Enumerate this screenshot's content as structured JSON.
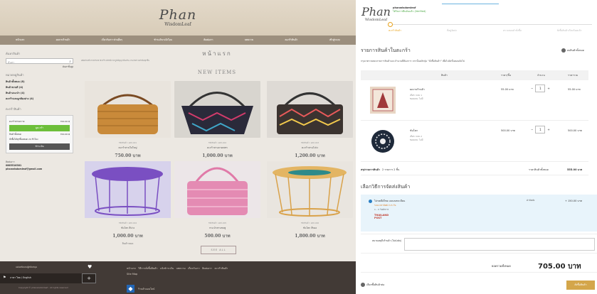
{
  "left": {
    "logo": {
      "line1": "Phan",
      "line2": "WisdomLeaf"
    },
    "nav": [
      "หน้าแรก",
      "ผลงานร้านค้า",
      "เกี่ยวกับเรา-ส่วนอื่นๆ",
      "ชำระเงิน-แจ้งโอน",
      "ติดต่อเรา",
      "บทความ",
      "ตะกร้าสินค้า",
      "เข้าสู่ระบบ"
    ],
    "sidebar": {
      "search_heading": "ค้นหาสินค้า",
      "search_placeholder": "ค้นหา",
      "advanced_search": "ค้นหาขั้นสูง",
      "categories_heading": "หมวดหมู่สินค้า",
      "categories": [
        "สินค้าทั้งหมด (8)",
        "สินค้าขายดี (4)",
        "สินค้าแนะนำ (4)",
        "ตะกร้าและผูกท้องย่าง (4)"
      ],
      "cart_heading": "ตะกร้าสินค้า",
      "cart_rows": [
        {
          "label": "ตะกร้าสานหวาย",
          "value": "700.00 ฿"
        },
        {
          "label": "สินค้าทั้งหมด",
          "value": "700.00 ฿"
        }
      ],
      "view_cart": "ดูตะกร้า",
      "cart_note": "สั่งซื้อได้ทุกชิ้นตลอด 24 ชั่วโมง",
      "checkout": "ชำระเงิน",
      "contact_heading": "ติดต่อเรา",
      "phone": "0865516381",
      "email": "phanwisdomleaf@gmail.com"
    },
    "main": {
      "title": "หน้าแรก",
      "intro": "ผลิตภัณฑ์จากธรรมชาติ สร้างสรรค์จากภูมิปัญญาท้องถิ่น งานจักสานทำมือทุกชิ้น",
      "new_items": "NEW ITEMS",
      "products": [
        {
          "code": "รหัสสินค้า: ผลส-001",
          "name": "ตะกร้าสานใบใหญ่",
          "price": "750.00 บาท",
          "badge": ""
        },
        {
          "code": "รหัสสินค้า: ผลส-002",
          "name": "ตะกร้าสานลายเพชร",
          "price": "1,000.00 บาท",
          "badge": ""
        },
        {
          "code": "รหัสสินค้า: ผลส-003",
          "name": "ตะกร้าสานโปร่ง",
          "price": "1,200.00 บาท",
          "badge": ""
        },
        {
          "code": "รหัสสินค้า: ผลส-004",
          "name": "ขันโตก สีม่วง",
          "price": "1,000.00 บาท",
          "badge": "สินค้าหมด"
        },
        {
          "code": "รหัสสินค้า: ผลส-005",
          "name": "กระเป๋าสานชมพู",
          "price": "500.00 บาท",
          "badge": ""
        },
        {
          "code": "รหัสสินค้า: ผลส-006",
          "name": "ขันโตก สีทอง",
          "price": "1,800.00 บาท",
          "badge": ""
        }
      ],
      "see_all": "SEE ALL"
    },
    "footer": {
      "left_text": "แผ่นหลังและผู้สนับสนุน",
      "nav": [
        "หน้าแรก",
        "วิธีการสั่งซื้อสินค้า",
        "แจ้งชำระเงิน",
        "บทความ",
        "เกี่ยวกับเรา",
        "ติดต่อเรา",
        "ตะกร้าสินค้า",
        "Site Map"
      ],
      "lang": "ภาษา ไทย / English",
      "plus": "+",
      "copyright": "Copyright © phanwisdomleaf - All rights reserved",
      "badge_text": "ร้านค้าออนไลน์",
      "badge_letter": "◆"
    }
  },
  "right": {
    "logo": {
      "line1": "Phan",
      "line2": "WisdomLeaf"
    },
    "shop": {
      "name": "phanwisdomleaf",
      "status": "ได้รับการยืนยันแล้ว (Verified)"
    },
    "steps": [
      "ตะกร้าสินค้า",
      "ที่อยู่จัดส่ง",
      "ตรวจสอบคำสั่งซื้อ",
      "สั่งซื้อสินค้าเรียบร้อยแล้ว"
    ],
    "cart_title": "รายการสินค้าในตะกร้า",
    "clear_cart": "ลบสินค้าทั้งหมด",
    "instructions": "กรุณาตรวจสอบรายการสินค้าและจำนวนที่ต้องการ จากนั้นคลิกปุ่ม \"สั่งซื้อสินค้า\" เพื่อไปยังขั้นตอนถัดไป",
    "columns": [
      "สินค้า",
      "ราคา/ชิ้น",
      "จำนวน",
      "ราคารวม"
    ],
    "items": [
      {
        "name": "ผลงานร้านค้า",
        "sub1": "เลือก: แบบ 1",
        "sub2": "ของแถม: ไม่มี",
        "unit": "55.00 บาท",
        "qty": "1",
        "total": "55.00 บาท"
      },
      {
        "name": "ขันโตก",
        "sub1": "เลือก: แบบ 2",
        "sub2": "ของแถม: ไม่มี",
        "unit": "500.00 บาท",
        "qty": "1",
        "total": "500.00 บาท"
      }
    ],
    "summary": {
      "label": "สรุปรายการสินค้า",
      "count": "2 รายการ 2 ชิ้น",
      "subtotal_label": "ราคาสินค้าทั้งหมด",
      "subtotal": "555.00 บาท"
    },
    "shipping": {
      "title": "เลือกวิธีการจัดส่งสินค้า",
      "option": "ไปรษณีย์ไทย แบบลงทะเบียน",
      "time": "ระยะเวลาจัดส่ง 3-5 วัน",
      "note": "1 - 3 วันทำการ",
      "brand": "THAILAND POST",
      "fee_label": "ค่าจัดส่ง",
      "fee": "+ 150.00 บาท"
    },
    "note_label": "หมายเหตุถึงร้านค้า (ไม่บังคับ)",
    "grand_label": "ยอดรวมทั้งหมด",
    "grand_total": "705.00 บาท",
    "back": "เลือกซื้อสินค้าต่อ",
    "next": "สั่งซื้อสินค้า"
  }
}
